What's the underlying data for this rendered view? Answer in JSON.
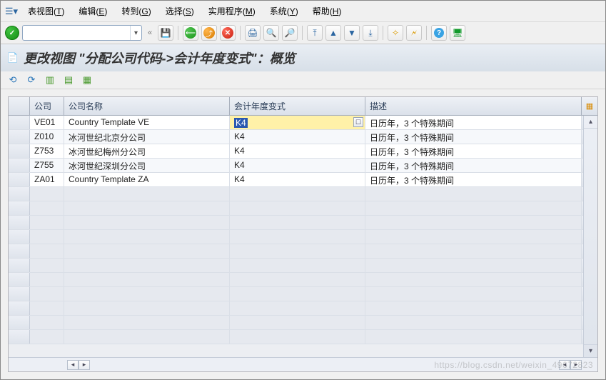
{
  "menu": {
    "view": {
      "label": "表视图",
      "hot": "T"
    },
    "edit": {
      "label": "编辑",
      "hot": "E"
    },
    "goto": {
      "label": "转到",
      "hot": "G"
    },
    "select": {
      "label": "选择",
      "hot": "S"
    },
    "util": {
      "label": "实用程序",
      "hot": "M"
    },
    "system": {
      "label": "系统",
      "hot": "Y"
    },
    "help": {
      "label": "帮助",
      "hot": "H"
    }
  },
  "command_value": "",
  "title": "更改视图 \"分配公司代码->会计年度变式\"：概览",
  "columns": {
    "sel": "",
    "code": "公司",
    "name": "公司名称",
    "variant": "会计年度变式",
    "desc": "描述"
  },
  "rows": [
    {
      "code": "VE01",
      "name": "Country Template VE",
      "variant": "K4",
      "desc": "日历年，3 个特殊期间",
      "editing": true
    },
    {
      "code": "Z010",
      "name": "冰河世纪北京分公司",
      "variant": "K4",
      "desc": "日历年，3 个特殊期间"
    },
    {
      "code": "Z753",
      "name": "冰河世纪梅州分公司",
      "variant": "K4",
      "desc": "日历年，3 个特殊期间"
    },
    {
      "code": "Z755",
      "name": "冰河世纪深圳分公司",
      "variant": "K4",
      "desc": "日历年，3 个特殊期间"
    },
    {
      "code": "ZA01",
      "name": "Country Template ZA",
      "variant": "K4",
      "desc": "日历年，3 个特殊期间"
    }
  ],
  "empty_row_count": 11,
  "watermark": "https://blog.csdn.net/weixin_49672823"
}
